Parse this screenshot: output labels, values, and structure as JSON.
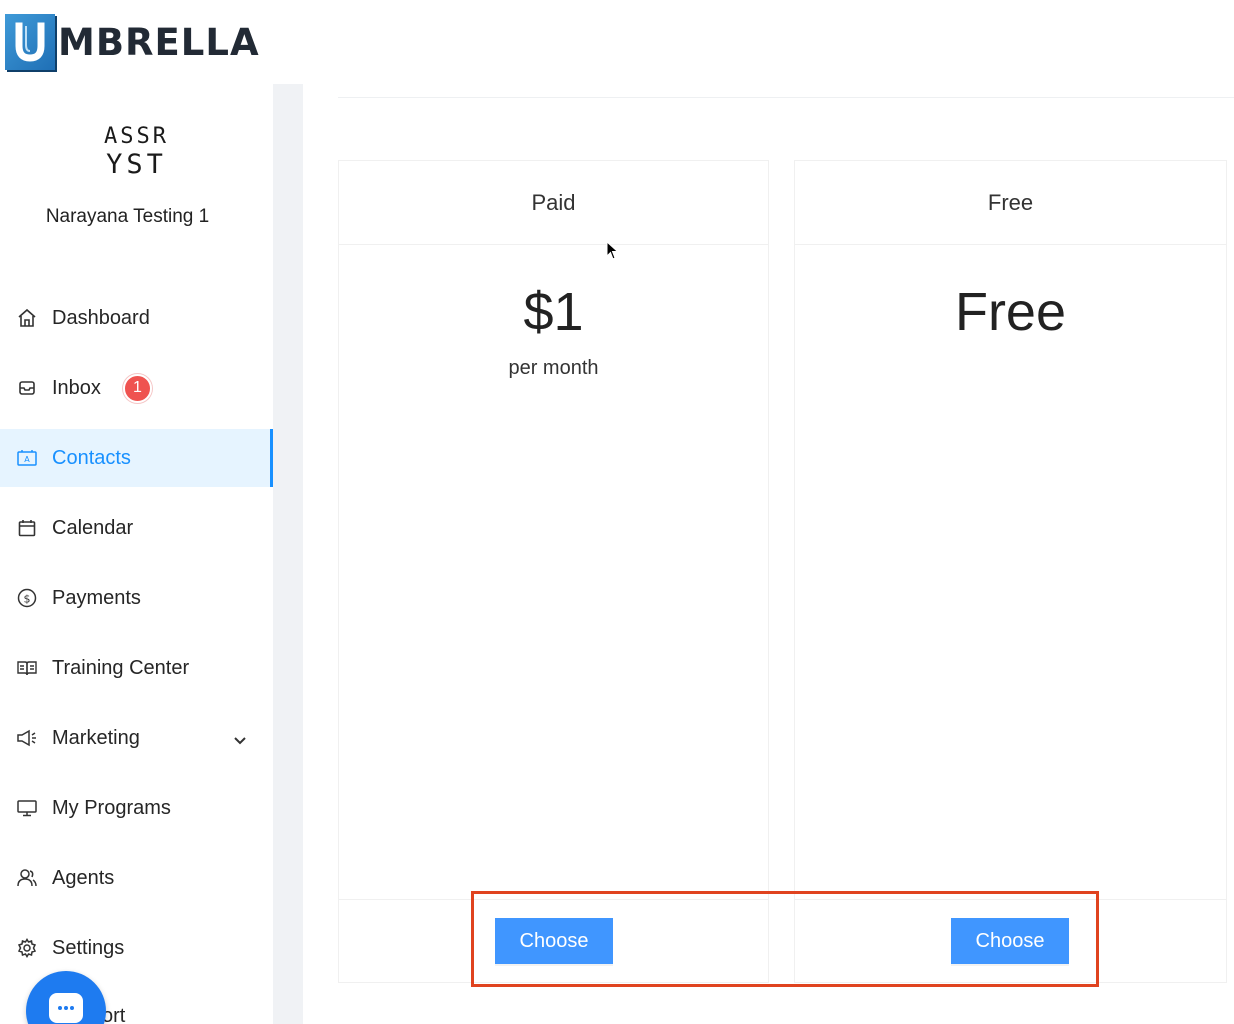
{
  "brand": {
    "logo_text": "MBRELLA",
    "logo_letter": "U"
  },
  "org": {
    "logo_line1": "ASSR",
    "logo_line2": "YST",
    "name": "Narayana Testing 1"
  },
  "sidebar": {
    "items": [
      {
        "label": "Dashboard",
        "icon": "home-icon"
      },
      {
        "label": "Inbox",
        "icon": "inbox-icon",
        "badge": "1"
      },
      {
        "label": "Contacts",
        "icon": "contacts-icon",
        "active": true
      },
      {
        "label": "Calendar",
        "icon": "calendar-icon"
      },
      {
        "label": "Payments",
        "icon": "dollar-circle-icon"
      },
      {
        "label": "Training Center",
        "icon": "book-icon"
      },
      {
        "label": "Marketing",
        "icon": "megaphone-icon",
        "expandable": true
      },
      {
        "label": "My Programs",
        "icon": "monitor-icon"
      },
      {
        "label": "Agents",
        "icon": "users-icon"
      },
      {
        "label": "Settings",
        "icon": "gear-icon"
      }
    ],
    "partial_item_label": "ort"
  },
  "plans": [
    {
      "name": "Paid",
      "price": "$1",
      "period": "per month",
      "button": "Choose"
    },
    {
      "name": "Free",
      "price": "Free",
      "period": "",
      "button": "Choose"
    }
  ],
  "colors": {
    "accent": "#1890ff",
    "button": "#4096ff",
    "badge": "#ef5350",
    "highlight": "#e0431f",
    "fab": "#1e7bf0"
  }
}
